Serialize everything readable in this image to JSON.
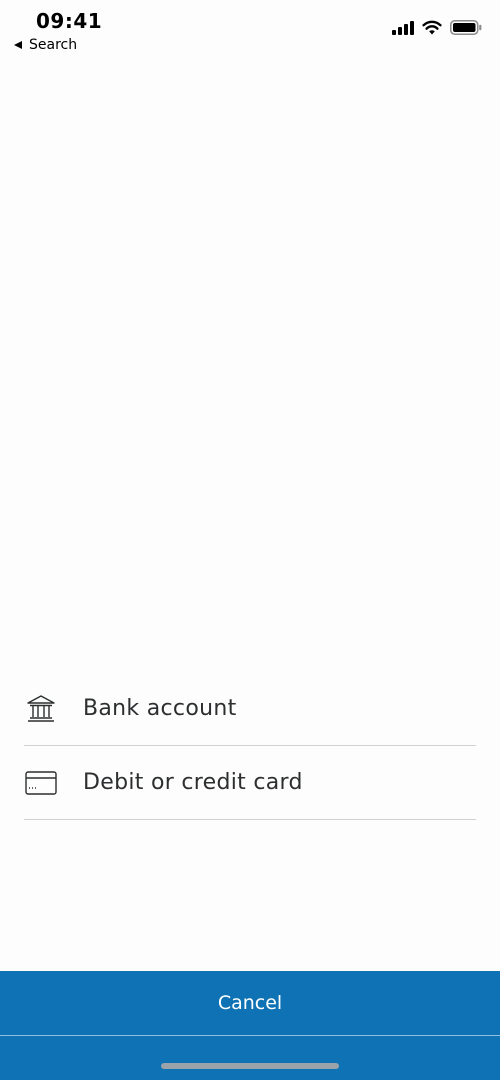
{
  "status_bar": {
    "time": "09:41",
    "back_label": "Search"
  },
  "options": [
    {
      "label": "Bank account",
      "icon": "bank-icon"
    },
    {
      "label": "Debit or credit card",
      "icon": "credit-card-icon"
    }
  ],
  "cancel": {
    "label": "Cancel"
  },
  "colors": {
    "accent": "#0e72b4",
    "text": "#2c2e2f",
    "divider": "#cfd1d3"
  }
}
